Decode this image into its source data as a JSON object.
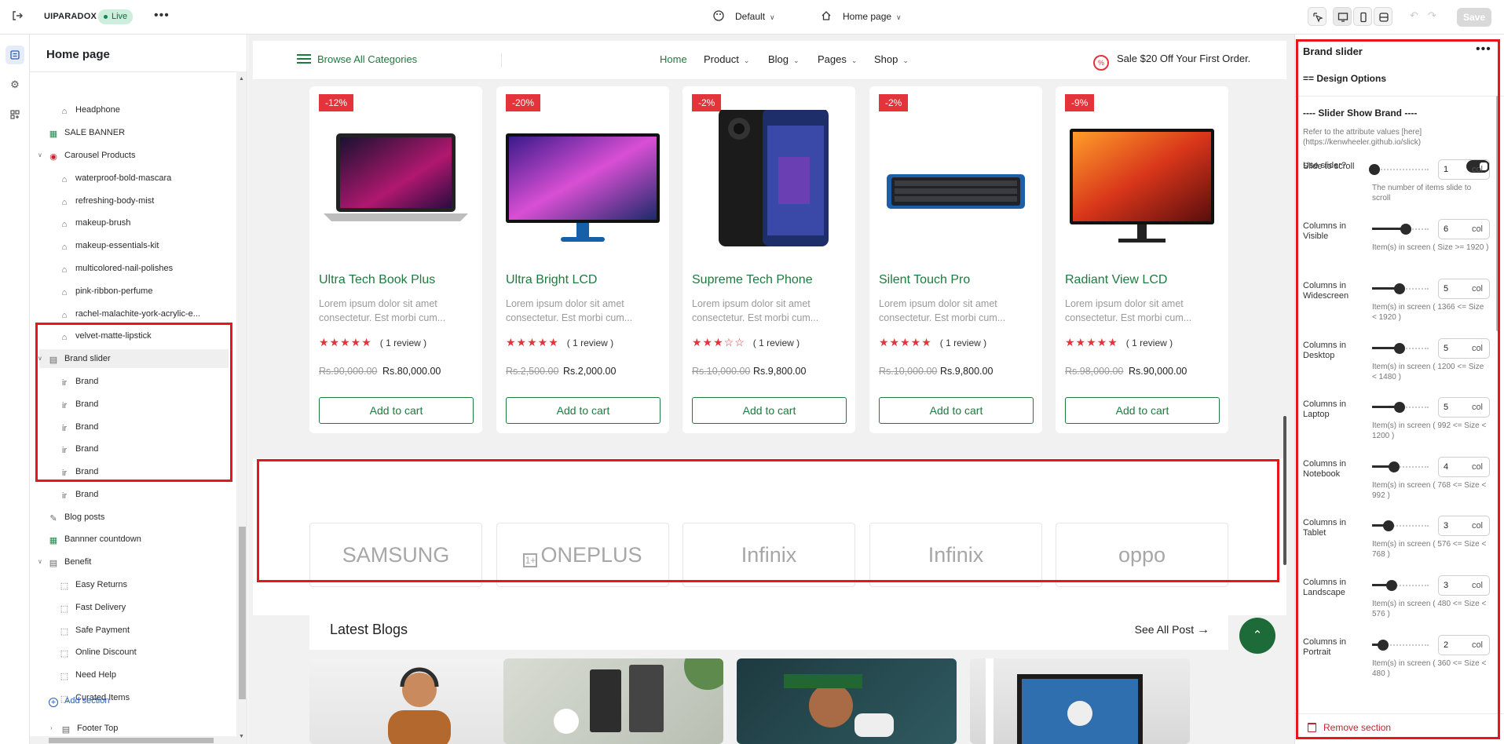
{
  "topbar": {
    "store_name": "UIPARADOX",
    "status": "Live",
    "theme_selector": "Default",
    "page_selector": "Home page",
    "save_label": "Save"
  },
  "left_panel": {
    "title": "Home page",
    "items": [
      {
        "label": "Headphone",
        "level": 2,
        "icon": "tag-icon"
      },
      {
        "label": "SALE BANNER",
        "level": 1,
        "icon": "banner-icon"
      },
      {
        "label": "Carousel Products",
        "level": 1,
        "icon": "product-icon",
        "expanded": true
      },
      {
        "label": "waterproof-bold-mascara",
        "level": 2,
        "icon": "tag-icon"
      },
      {
        "label": "refreshing-body-mist",
        "level": 2,
        "icon": "tag-icon"
      },
      {
        "label": "makeup-brush",
        "level": 2,
        "icon": "tag-icon"
      },
      {
        "label": "makeup-essentials-kit",
        "level": 2,
        "icon": "tag-icon"
      },
      {
        "label": "multicolored-nail-polishes",
        "level": 2,
        "icon": "tag-icon"
      },
      {
        "label": "pink-ribbon-perfume",
        "level": 2,
        "icon": "tag-icon"
      },
      {
        "label": "rachel-malachite-york-acrylic-e...",
        "level": 2,
        "icon": "tag-icon"
      },
      {
        "label": "velvet-matte-lipstick",
        "level": 2,
        "icon": "tag-icon"
      },
      {
        "label": "Brand slider",
        "level": 1,
        "icon": "section-icon",
        "expanded": true,
        "selected": true
      },
      {
        "label": "Brand",
        "level": 2,
        "icon": "brand-thumb-icon"
      },
      {
        "label": "Brand",
        "level": 2,
        "icon": "brand-thumb-icon"
      },
      {
        "label": "Brand",
        "level": 2,
        "icon": "brand-thumb-icon"
      },
      {
        "label": "Brand",
        "level": 2,
        "icon": "brand-thumb-icon"
      },
      {
        "label": "Brand",
        "level": 2,
        "icon": "brand-thumb-icon"
      },
      {
        "label": "Brand",
        "level": 2,
        "icon": "brand-thumb-icon"
      },
      {
        "label": "Blog posts",
        "level": 1,
        "icon": "edit-icon"
      },
      {
        "label": "Bannner countdown",
        "level": 1,
        "icon": "banner-icon"
      },
      {
        "label": "Benefit",
        "level": 1,
        "icon": "section-icon",
        "expanded": true
      },
      {
        "label": "Easy Returns",
        "level": 2,
        "icon": "block-icon"
      },
      {
        "label": "Fast Delivery",
        "level": 2,
        "icon": "block-icon"
      },
      {
        "label": "Safe Payment",
        "level": 2,
        "icon": "block-icon"
      },
      {
        "label": "Online Discount",
        "level": 2,
        "icon": "block-icon"
      },
      {
        "label": "Need Help",
        "level": 2,
        "icon": "block-icon"
      },
      {
        "label": "Curated Items",
        "level": 2,
        "icon": "block-icon"
      }
    ],
    "add_section": "Add section",
    "footer_item": "Footer Top"
  },
  "store_nav": {
    "browse": "Browse All Categories",
    "links": [
      "Home",
      "Product",
      "Blog",
      "Pages",
      "Shop"
    ],
    "sale": "Sale $20 Off Your First Order."
  },
  "products": [
    {
      "badge": "-12%",
      "name": "Ultra Tech Book Plus",
      "desc": "Lorem ipsum dolor sit amet consectetur. Est morbi cum...",
      "stars": "★★★★★",
      "rating": "( 1 review )",
      "old_price": "Rs.90,000.00",
      "price": "Rs.80,000.00",
      "cart": "Add to cart"
    },
    {
      "badge": "-20%",
      "name": "Ultra Bright LCD",
      "desc": "Lorem ipsum dolor sit amet consectetur. Est morbi cum...",
      "stars": "★★★★★",
      "rating": "( 1 review )",
      "old_price": "Rs.2,500.00",
      "price": "Rs.2,000.00",
      "cart": "Add to cart"
    },
    {
      "badge": "-2%",
      "name": "Supreme Tech Phone",
      "desc": "Lorem ipsum dolor sit amet consectetur. Est morbi cum...",
      "stars": "★★★☆☆",
      "rating": "( 1 review )",
      "old_price": "Rs.10,000.00",
      "price": "Rs.9,800.00",
      "cart": "Add to cart"
    },
    {
      "badge": "-2%",
      "name": "Silent Touch Pro",
      "desc": "Lorem ipsum dolor sit amet consectetur. Est morbi cum...",
      "stars": "★★★★★",
      "rating": "( 1 review )",
      "old_price": "Rs.10,000.00",
      "price": "Rs.9,800.00",
      "cart": "Add to cart"
    },
    {
      "badge": "-9%",
      "name": "Radiant View LCD",
      "desc": "Lorem ipsum dolor sit amet consectetur. Est morbi cum...",
      "stars": "★★★★★",
      "rating": "( 1 review )",
      "old_price": "Rs.98,000.00",
      "price": "Rs.90,000.00",
      "cart": "Add to cart"
    }
  ],
  "brands": [
    "SAMSUNG",
    "ONEPLUS",
    "Infinix",
    "Infinix",
    "oppo"
  ],
  "blogs": {
    "title": "Latest Blogs",
    "see_all": "See All Post"
  },
  "settings_panel": {
    "title": "Brand slider",
    "design_options": "== Design Options",
    "slider_show_brand": "---- Slider Show Brand ----",
    "reference": "Refer to the attribute values [here](https://kenwheeler.github.io/slick)",
    "use_slider_label": "Use slider?",
    "use_slider": true,
    "unit": "col",
    "fields": [
      {
        "label": "Slide to scroll",
        "value": "1",
        "level": 0.0,
        "help": "The number of items slide to scroll"
      },
      {
        "label": "Columns in Visible",
        "value": "6",
        "level": 0.55,
        "help": "Item(s) in screen ( Size >= 1920 )"
      },
      {
        "label": "Columns in Widescreen",
        "value": "5",
        "level": 0.45,
        "help": "Item(s) in screen ( 1366 <= Size < 1920 )"
      },
      {
        "label": "Columns in Desktop",
        "value": "5",
        "level": 0.45,
        "help": "Item(s) in screen ( 1200 <= Size < 1480 )"
      },
      {
        "label": "Columns in Laptop",
        "value": "5",
        "level": 0.45,
        "help": "Item(s) in screen ( 992 <= Size < 1200 )"
      },
      {
        "label": "Columns in Notebook",
        "value": "4",
        "level": 0.35,
        "help": "Item(s) in screen ( 768 <= Size < 992 )"
      },
      {
        "label": "Columns in Tablet",
        "value": "3",
        "level": 0.25,
        "help": "Item(s) in screen ( 576 <= Size < 768 )"
      },
      {
        "label": "Columns in Landscape",
        "value": "3",
        "level": 0.3,
        "help": "Item(s) in screen ( 480 <= Size < 576 )"
      },
      {
        "label": "Columns in Portrait",
        "value": "2",
        "level": 0.15,
        "help": "Item(s) in screen ( 360 <= Size < 480 )"
      }
    ],
    "remove_section": "Remove section"
  },
  "colors": {
    "accent_green": "#1e7a3e",
    "sale_red": "#e2343a",
    "highlight": "#e8151b"
  }
}
